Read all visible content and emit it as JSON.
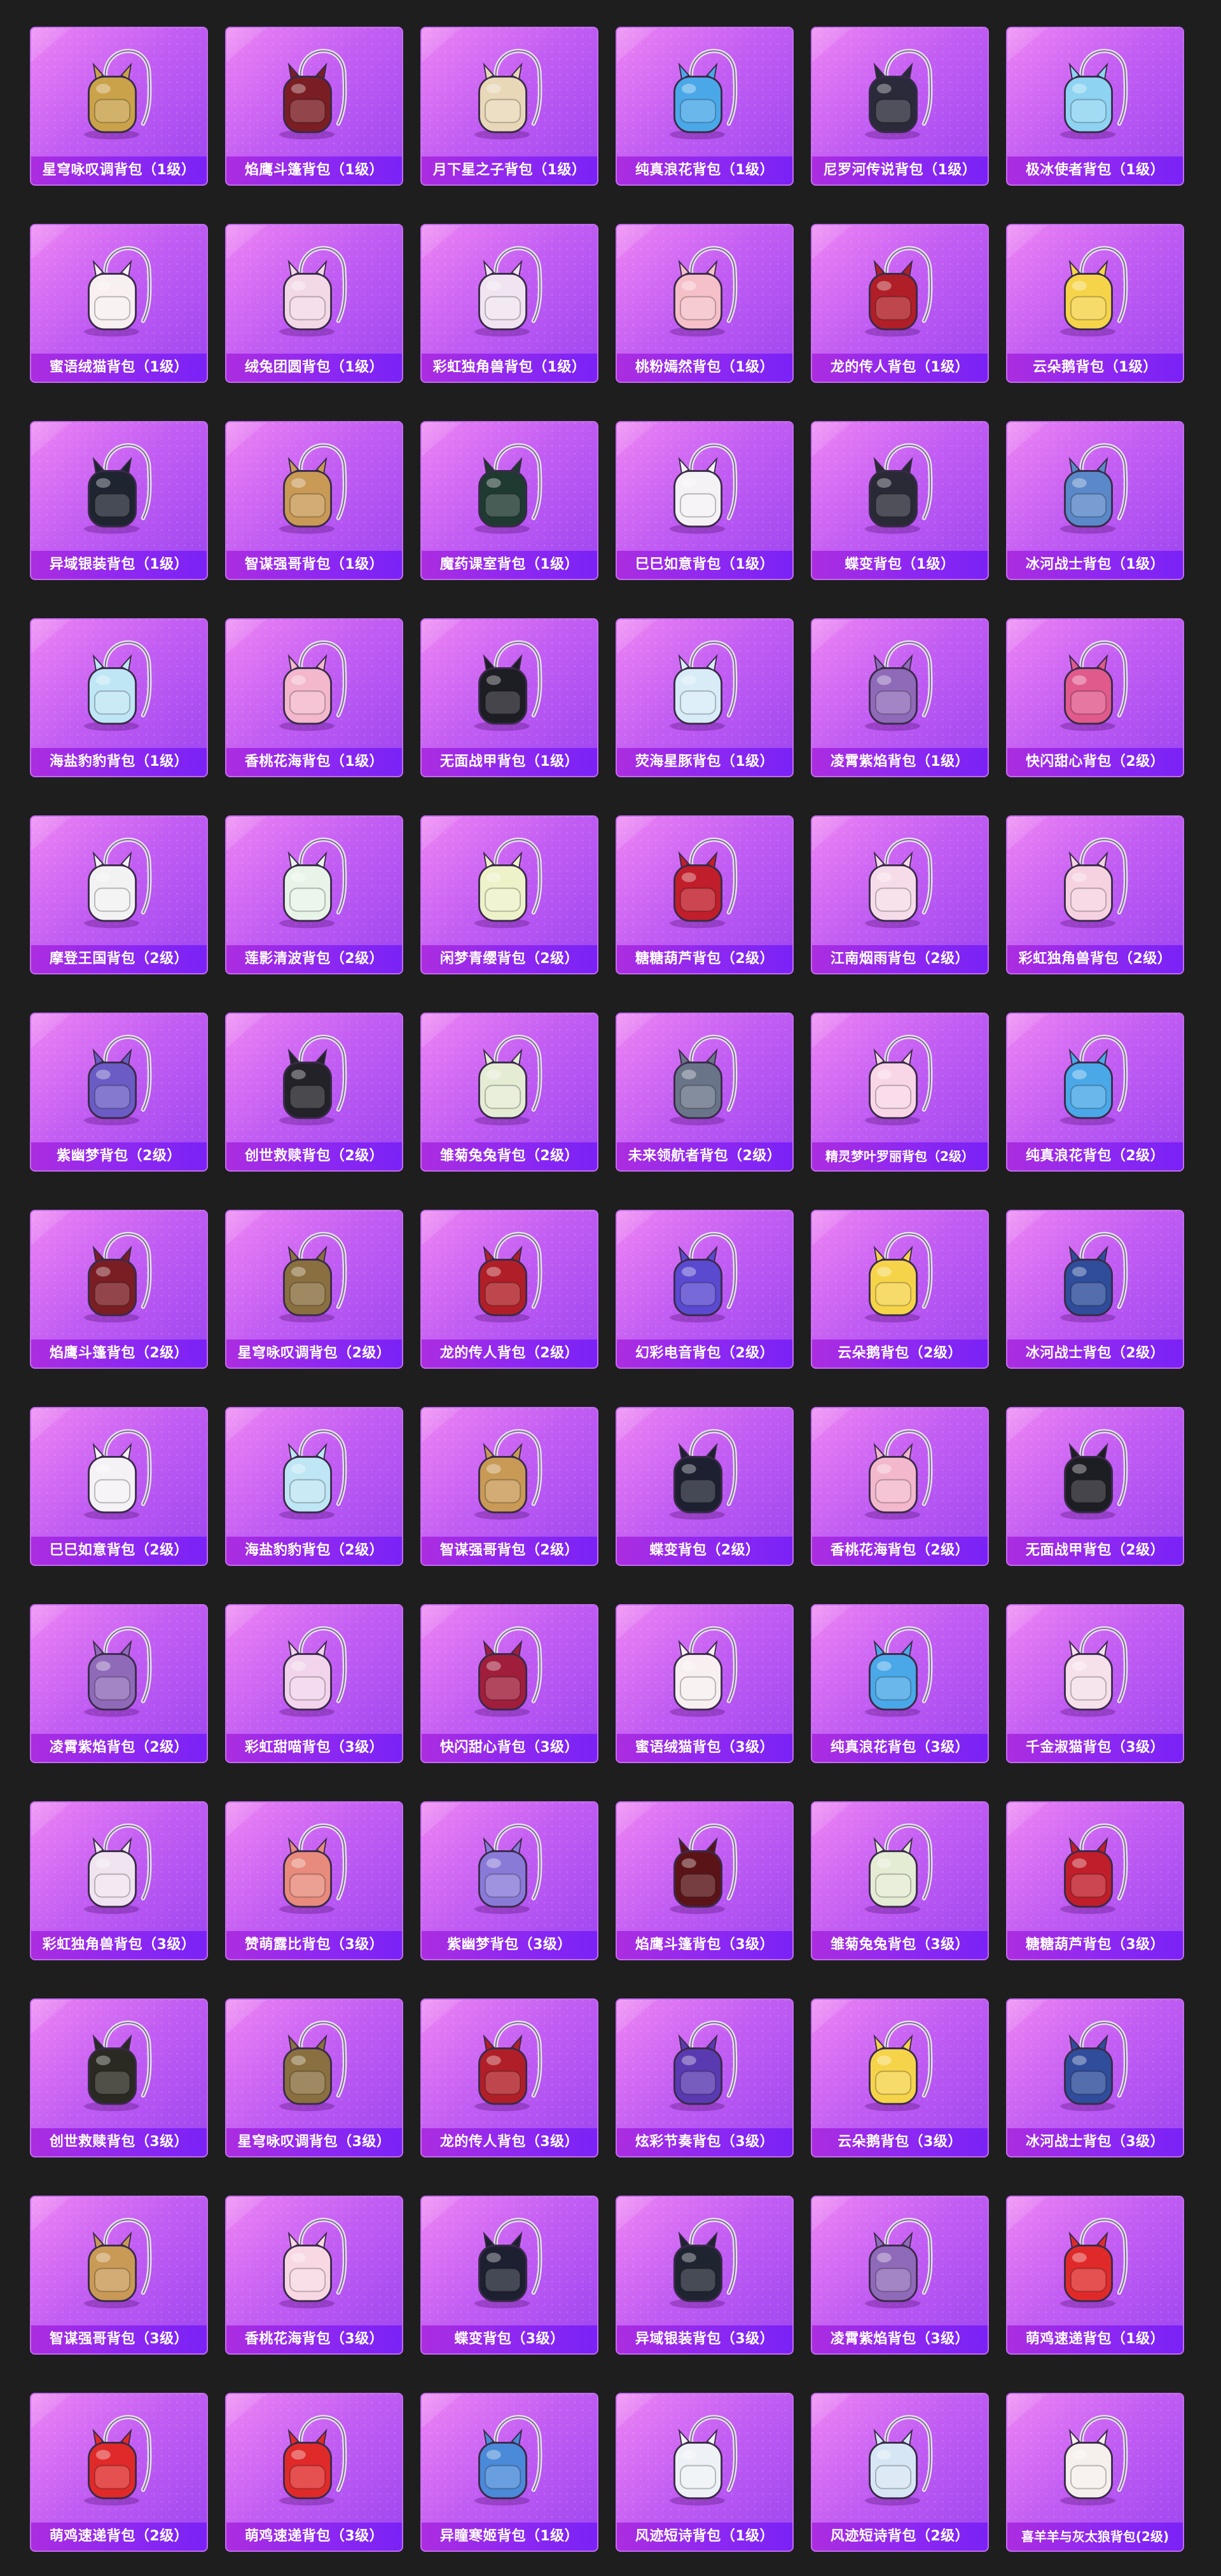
{
  "items": [
    {
      "name": "星穹咏叹调背包（1级）",
      "icon": "backpack-icon",
      "color": "#c9a24a"
    },
    {
      "name": "焰鹰斗篷背包（1级）",
      "icon": "backpack-icon",
      "color": "#7a1e24"
    },
    {
      "name": "月下星之子背包（1级）",
      "icon": "backpack-icon",
      "color": "#e8d8b8"
    },
    {
      "name": "纯真浪花背包（1级）",
      "icon": "backpack-icon",
      "color": "#4aa8e8"
    },
    {
      "name": "尼罗河传说背包（1级）",
      "icon": "backpack-icon",
      "color": "#2a2a3a"
    },
    {
      "name": "极冰使者背包（1级）",
      "icon": "backpack-icon",
      "color": "#8ed4f2"
    },
    {
      "name": "蜜语绒猫背包（1级）",
      "icon": "backpack-icon",
      "color": "#f7eff0"
    },
    {
      "name": "绒兔团圆背包（1级）",
      "icon": "backpack-icon",
      "color": "#f3d8e6"
    },
    {
      "name": "彩虹独角兽背包（1级）",
      "icon": "backpack-icon",
      "color": "#f0e4f0"
    },
    {
      "name": "桃粉嫣然背包（1级）",
      "icon": "backpack-icon",
      "color": "#f6c0c8"
    },
    {
      "name": "龙的传人背包（1级）",
      "icon": "backpack-icon",
      "color": "#b01f28"
    },
    {
      "name": "云朵鹅背包（1级）",
      "icon": "backpack-icon",
      "color": "#f6d44a"
    },
    {
      "name": "异域银装背包（1级）",
      "icon": "backpack-icon",
      "color": "#1e2430"
    },
    {
      "name": "智谋强哥背包（1级）",
      "icon": "backpack-icon",
      "color": "#c89a56"
    },
    {
      "name": "魔药课室背包（1级）",
      "icon": "backpack-icon",
      "color": "#1f3a30"
    },
    {
      "name": "巳巳如意背包（1级）",
      "icon": "backpack-icon",
      "color": "#f4f2f4"
    },
    {
      "name": "蝶变背包（1级）",
      "icon": "backpack-icon",
      "color": "#2a2a36"
    },
    {
      "name": "冰河战士背包（1级）",
      "icon": "backpack-icon",
      "color": "#5a88c8"
    },
    {
      "name": "海盐豹豹背包（1级）",
      "icon": "backpack-icon",
      "color": "#bfe6f4"
    },
    {
      "name": "香桃花海背包（1级）",
      "icon": "backpack-icon",
      "color": "#f3b8cc"
    },
    {
      "name": "无面战甲背包（1级）",
      "icon": "backpack-icon",
      "color": "#1d1d24"
    },
    {
      "name": "荧海星豚背包（1级）",
      "icon": "backpack-icon",
      "color": "#d8ecf8"
    },
    {
      "name": "凌霄紫焰背包（1级）",
      "icon": "backpack-icon",
      "color": "#8f6ab8"
    },
    {
      "name": "快闪甜心背包（2级）",
      "icon": "backpack-icon",
      "color": "#e05a8c"
    },
    {
      "name": "摩登王国背包（2级）",
      "icon": "backpack-icon",
      "color": "#f2f2f2"
    },
    {
      "name": "莲影清波背包（2级）",
      "icon": "backpack-icon",
      "color": "#e8f4e8"
    },
    {
      "name": "闲梦青缨背包（2级）",
      "icon": "backpack-icon",
      "color": "#eef2c8"
    },
    {
      "name": "糖糖葫芦背包（2级）",
      "icon": "backpack-icon",
      "color": "#c01e2a"
    },
    {
      "name": "江南烟雨背包（2级）",
      "icon": "backpack-icon",
      "color": "#f6dce8"
    },
    {
      "name": "彩虹独角兽背包（2级）",
      "icon": "backpack-icon",
      "color": "#f6d2e0"
    },
    {
      "name": "紫幽梦背包（2级）",
      "icon": "backpack-icon",
      "color": "#6a5cc4"
    },
    {
      "name": "创世救赎背包（2级）",
      "icon": "backpack-icon",
      "color": "#222228"
    },
    {
      "name": "雏菊兔兔背包（2级）",
      "icon": "backpack-icon",
      "color": "#e4ecd4"
    },
    {
      "name": "未来领航者背包（2级）",
      "icon": "backpack-icon",
      "color": "#6a7488"
    },
    {
      "name": "精灵梦叶罗丽背包（2级）",
      "icon": "backpack-icon",
      "color": "#f8d6e6"
    },
    {
      "name": "纯真浪花背包（2级）",
      "icon": "backpack-icon",
      "color": "#4aa8e8"
    },
    {
      "name": "焰鹰斗篷背包（2级）",
      "icon": "backpack-icon",
      "color": "#7a1e24"
    },
    {
      "name": "星穹咏叹调背包（2级）",
      "icon": "backpack-icon",
      "color": "#8a7040"
    },
    {
      "name": "龙的传人背包（2级）",
      "icon": "backpack-icon",
      "color": "#b01f28"
    },
    {
      "name": "幻彩电音背包（2级）",
      "icon": "backpack-icon",
      "color": "#5a4ad0"
    },
    {
      "name": "云朵鹅背包（2级）",
      "icon": "backpack-icon",
      "color": "#f6d44a"
    },
    {
      "name": "冰河战士背包（2级）",
      "icon": "backpack-icon",
      "color": "#2f4d9a"
    },
    {
      "name": "巳巳如意背包（2级）",
      "icon": "backpack-icon",
      "color": "#f4f2f4"
    },
    {
      "name": "海盐豹豹背包（2级）",
      "icon": "backpack-icon",
      "color": "#bfe6f4"
    },
    {
      "name": "智谋强哥背包（2级）",
      "icon": "backpack-icon",
      "color": "#c89a56"
    },
    {
      "name": "蝶变背包（2级）",
      "icon": "backpack-icon",
      "color": "#1d2030"
    },
    {
      "name": "香桃花海背包（2级）",
      "icon": "backpack-icon",
      "color": "#f3b8cc"
    },
    {
      "name": "无面战甲背包（2级）",
      "icon": "backpack-icon",
      "color": "#1d1d24"
    },
    {
      "name": "凌霄紫焰背包（2级）",
      "icon": "backpack-icon",
      "color": "#8f6ab8"
    },
    {
      "name": "彩虹甜喵背包（3级）",
      "icon": "backpack-icon",
      "color": "#f2d4ec"
    },
    {
      "name": "快闪甜心背包（3级）",
      "icon": "backpack-icon",
      "color": "#a01e3c"
    },
    {
      "name": "蜜语绒猫背包（3级）",
      "icon": "backpack-icon",
      "color": "#f7eff0"
    },
    {
      "name": "纯真浪花背包（3级）",
      "icon": "backpack-icon",
      "color": "#4aa8e8"
    },
    {
      "name": "千金淑猫背包（3级）",
      "icon": "backpack-icon",
      "color": "#f6e0ea"
    },
    {
      "name": "彩虹独角兽背包（3级）",
      "icon": "backpack-icon",
      "color": "#f0e4f0"
    },
    {
      "name": "赞萌露比背包（3级）",
      "icon": "backpack-icon",
      "color": "#e88a7c"
    },
    {
      "name": "紫幽梦背包（3级）",
      "icon": "backpack-icon",
      "color": "#8a7ad8"
    },
    {
      "name": "焰鹰斗篷背包（3级）",
      "icon": "backpack-icon",
      "color": "#5a1418"
    },
    {
      "name": "雏菊兔兔背包（3级）",
      "icon": "backpack-icon",
      "color": "#e4ecd4"
    },
    {
      "name": "糖糖葫芦背包（3级）",
      "icon": "backpack-icon",
      "color": "#c01e2a"
    },
    {
      "name": "创世救赎背包（3级）",
      "icon": "backpack-icon",
      "color": "#2a2a22"
    },
    {
      "name": "星穹咏叹调背包（3级）",
      "icon": "backpack-icon",
      "color": "#8a7040"
    },
    {
      "name": "龙的传人背包（3级）",
      "icon": "backpack-icon",
      "color": "#b01f28"
    },
    {
      "name": "炫彩节奏背包（3级）",
      "icon": "backpack-icon",
      "color": "#5a3ab0"
    },
    {
      "name": "云朵鹅背包（3级）",
      "icon": "backpack-icon",
      "color": "#f6d44a"
    },
    {
      "name": "冰河战士背包（3级）",
      "icon": "backpack-icon",
      "color": "#2f4d9a"
    },
    {
      "name": "智谋强哥背包（3级）",
      "icon": "backpack-icon",
      "color": "#c89a56"
    },
    {
      "name": "香桃花海背包（3级）",
      "icon": "backpack-icon",
      "color": "#f8d8e2"
    },
    {
      "name": "蝶变背包（3级）",
      "icon": "backpack-icon",
      "color": "#1d2030"
    },
    {
      "name": "异域银装背包（3级）",
      "icon": "backpack-icon",
      "color": "#1e2430"
    },
    {
      "name": "凌霄紫焰背包（3级）",
      "icon": "backpack-icon",
      "color": "#8f6ab8"
    },
    {
      "name": "萌鸡速递背包（1级）",
      "icon": "backpack-icon",
      "color": "#e02a2a"
    },
    {
      "name": "萌鸡速递背包（2级）",
      "icon": "backpack-icon",
      "color": "#e02a2a"
    },
    {
      "name": "萌鸡速递背包（3级）",
      "icon": "backpack-icon",
      "color": "#e02a2a"
    },
    {
      "name": "异瞳寒姬背包（1级）",
      "icon": "backpack-icon",
      "color": "#4a8ad8"
    },
    {
      "name": "风迹短诗背包（1级）",
      "icon": "backpack-icon",
      "color": "#eef2f6"
    },
    {
      "name": "风迹短诗背包（2级）",
      "icon": "backpack-icon",
      "color": "#d6e6f4"
    },
    {
      "name": "喜羊羊与灰太狼背包(2级)",
      "icon": "backpack-icon",
      "color": "#f6f0ec"
    }
  ]
}
